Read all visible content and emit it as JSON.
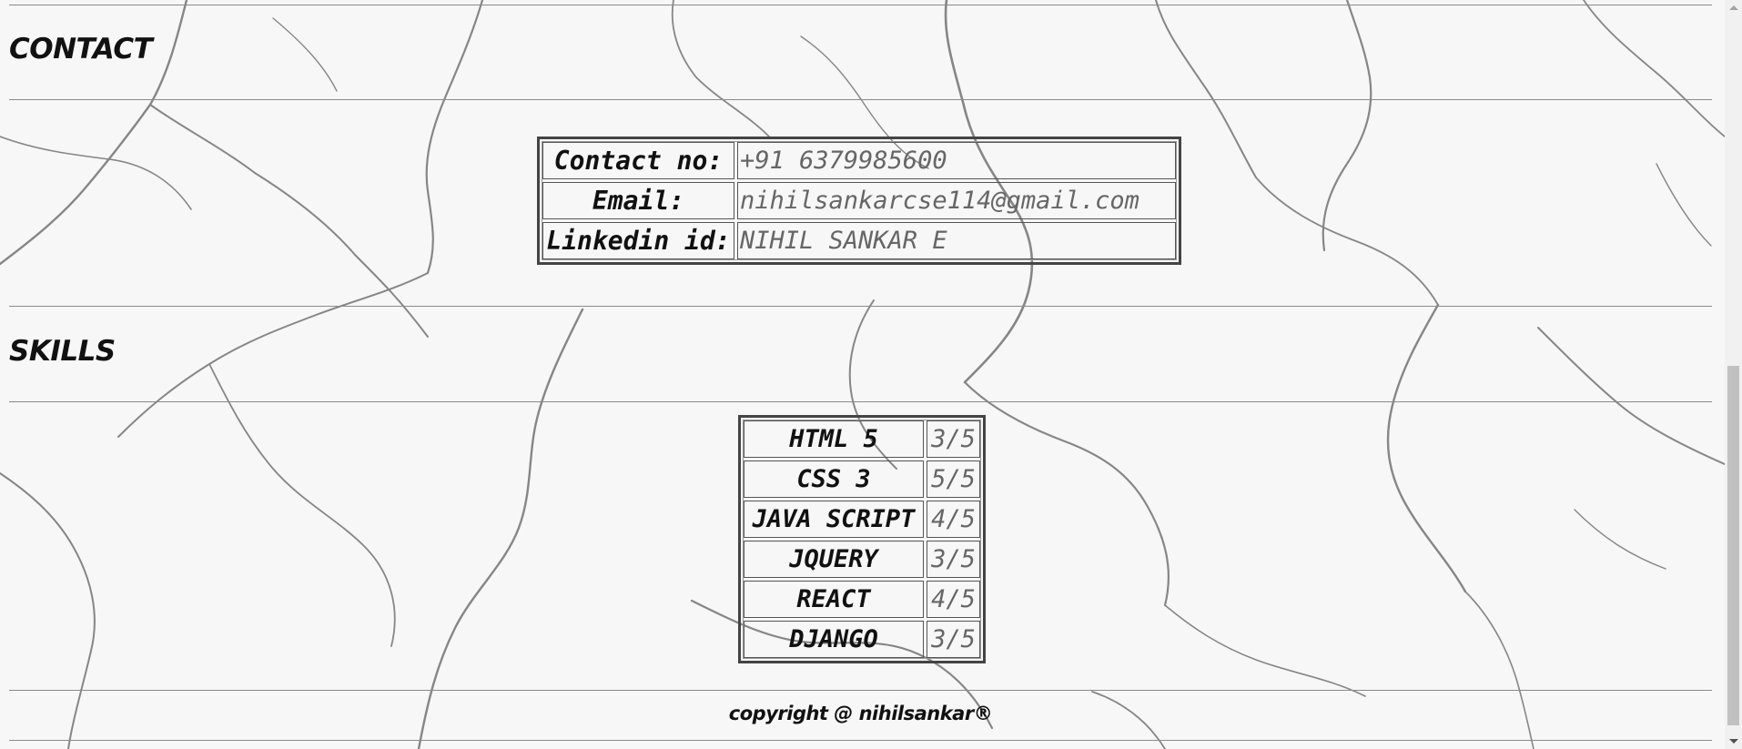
{
  "contact": {
    "title": "CONTACT",
    "rows": [
      {
        "label": "Contact no:",
        "value": "+91 6379985600"
      },
      {
        "label": "Email:",
        "value": "nihilsankarcse114@gmail.com"
      },
      {
        "label": "Linkedin id:",
        "value": "NIHIL SANKAR E"
      }
    ]
  },
  "skills": {
    "title": "SKILLS",
    "rows": [
      {
        "name": "HTML 5",
        "rating": "3/5"
      },
      {
        "name": "CSS 3",
        "rating": "5/5"
      },
      {
        "name": "JAVA SCRIPT",
        "rating": "4/5"
      },
      {
        "name": "JQUERY",
        "rating": "3/5"
      },
      {
        "name": "REACT",
        "rating": "4/5"
      },
      {
        "name": "DJANGO",
        "rating": "3/5"
      }
    ]
  },
  "footer": {
    "copyright": "copyright @ nihilsankar®"
  },
  "colors": {
    "background": "#f7f7f7",
    "crack": "#2a2a2a",
    "rule": "#8a8a8a",
    "value_text": "#666666"
  },
  "scrollbar": {
    "up_icon": "chevron-up-icon",
    "down_icon": "chevron-down-icon"
  }
}
